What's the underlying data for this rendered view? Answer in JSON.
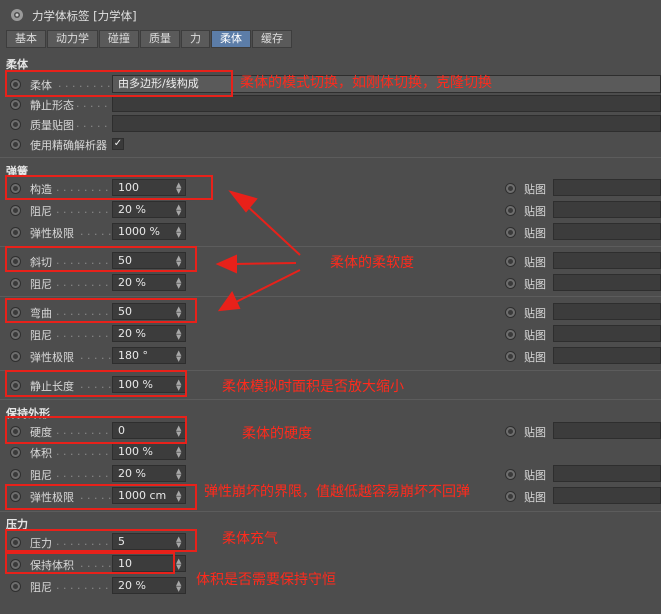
{
  "window": {
    "title": "力学体标签 [力学体]"
  },
  "tabs": [
    "基本",
    "动力学",
    "碰撞",
    "质量",
    "力",
    "柔体",
    "缓存"
  ],
  "sections": {
    "softbody": "柔体",
    "spring": "弹簧",
    "shape": "保持外形",
    "pressure": "压力"
  },
  "softbody": {
    "mode_label": "柔体",
    "mode_value": "由多边形/线构成",
    "rest_state_label": "静止形态",
    "mass_map_label": "质量贴图",
    "precise_solver_label": "使用精确解析器",
    "precise_solver_checked": true
  },
  "spring": {
    "structural_label": "构造",
    "structural_value": "100",
    "damping1_label": "阻尼",
    "damping1_value": "20 %",
    "elastic_limit1_label": "弹性极限",
    "elastic_limit1_value": "1000 %",
    "shear_label": "斜切",
    "shear_value": "50",
    "damping2_label": "阻尼",
    "damping2_value": "20 %",
    "flexion_label": "弯曲",
    "flexion_value": "50",
    "damping3_label": "阻尼",
    "damping3_value": "20 %",
    "elastic_limit3_label": "弹性极限",
    "elastic_limit3_value": "180 °",
    "rest_length_label": "静止长度",
    "rest_length_value": "100 %"
  },
  "shape": {
    "hardness_label": "硬度",
    "hardness_value": "0",
    "volume_label": "体积",
    "volume_value": "100 %",
    "damping_label": "阻尼",
    "damping_value": "20 %",
    "elastic_limit_label": "弹性极限",
    "elastic_limit_value": "1000 cm"
  },
  "pressure": {
    "pressure_label": "压力",
    "pressure_value": "5",
    "keep_volume_label": "保持体积",
    "keep_volume_value": "10",
    "damping_label": "阻尼",
    "damping_value": "20 %"
  },
  "map_label": "贴图",
  "annotations": {
    "mode_note": "柔体的模式切换，如刚体切换，克隆切换",
    "softness_note": "柔体的柔软度",
    "rest_length_note": "柔体模拟时面积是否放大缩小",
    "hardness_note": "柔体的硬度",
    "elastic_note": "弹性崩坏的界限，值越低越容易崩坏不回弹",
    "pressure_note": "柔体充气",
    "keep_volume_note": "体积是否需要保持守恒"
  },
  "colors": {
    "background": "#4d4d4d",
    "active_tab": "#5c7da8",
    "annotation_red": "#e8211a"
  },
  "icons": {
    "app_icon": "gear-icon",
    "radio": "keyframe-radio-icon"
  }
}
